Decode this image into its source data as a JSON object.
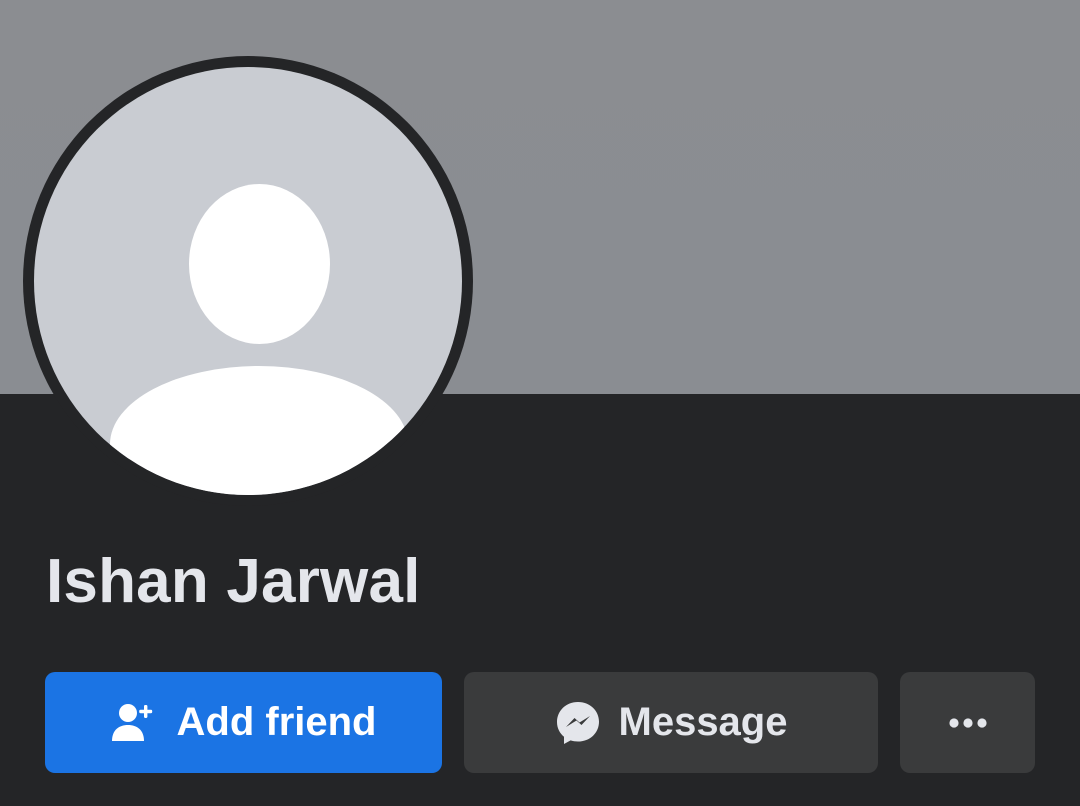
{
  "profile": {
    "name": "Ishan Jarwal"
  },
  "actions": {
    "add_friend_label": "Add friend",
    "message_label": "Message",
    "more_icon": "more-horizontal-icon"
  },
  "colors": {
    "cover": "#8b8d91",
    "background": "#242527",
    "primary_button": "#1b74e4",
    "secondary_button": "#3a3b3c",
    "name_text": "#e4e6eb"
  },
  "icons": {
    "add_friend": "add-person-icon",
    "message": "messenger-icon"
  }
}
